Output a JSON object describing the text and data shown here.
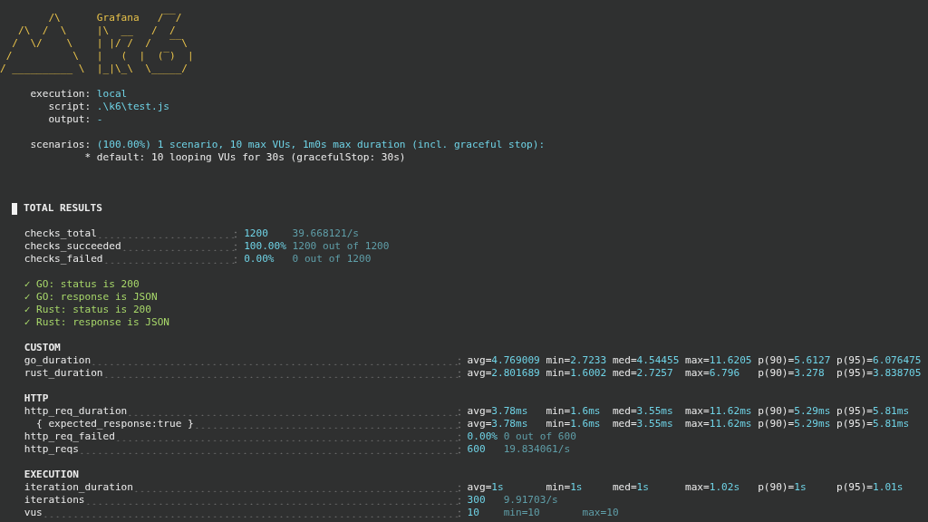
{
  "banner": {
    "lines": [
      "        /\\      Grafana   /‾‾/",
      "   /\\  /  \\     |\\  __   /  /",
      "  /  \\/    \\    | |/ /  /   ‾‾\\",
      " /          \\   |   (  |  (‾)  |",
      "/ __________ \\  |_|\\_\\  \\_____/"
    ]
  },
  "run_info": [
    {
      "field": "execution:",
      "setting": "local"
    },
    {
      "field": "script:",
      "setting": ".\\k6\\test.js"
    },
    {
      "field": "output:",
      "setting": "-"
    },
    {
      "field": "scenarios:",
      "setting": "(100.00%) 1 scenario, 10 max VUs, 1m0s max duration (incl. graceful stop):"
    }
  ],
  "scenario_detail": "* default: 10 looping VUs for 30s (gracefulStop: 30s)",
  "results_title": "TOTAL RESULTS",
  "checks": [
    {
      "name": "checks_total",
      "value": "1200",
      "extra": "39.668121/s"
    },
    {
      "name": "checks_succeeded",
      "value": "100.00%",
      "extra": "1200 out of 1200"
    },
    {
      "name": "checks_failed",
      "value": "0.00%",
      "extra": "0 out of 1200"
    }
  ],
  "check_list": [
    {
      "mark": "✓",
      "text": "GO: status is 200",
      "passed": true
    },
    {
      "mark": "✓",
      "text": "GO: response is JSON",
      "passed": true
    },
    {
      "mark": "✓",
      "text": "Rust: status is 200",
      "passed": true
    },
    {
      "mark": "✓",
      "text": "Rust: response is JSON",
      "passed": true
    }
  ],
  "groups": [
    {
      "title": "CUSTOM",
      "metrics": [
        {
          "kind": "trend",
          "name": "go_duration",
          "stats": [
            {
              "label": "avg=",
              "value": "4.769009"
            },
            {
              "label": "min=",
              "value": "2.7233"
            },
            {
              "label": "med=",
              "value": "4.54455"
            },
            {
              "label": "max=",
              "value": "11.6205"
            },
            {
              "label": "p(90)=",
              "value": "5.6127"
            },
            {
              "label": "p(95)=",
              "value": "6.076475"
            }
          ]
        },
        {
          "kind": "trend",
          "name": "rust_duration",
          "stats": [
            {
              "label": "avg=",
              "value": "2.801689"
            },
            {
              "label": "min=",
              "value": "1.6002"
            },
            {
              "label": "med=",
              "value": "2.7257"
            },
            {
              "label": "max=",
              "value": "6.796"
            },
            {
              "label": "p(90)=",
              "value": "3.278"
            },
            {
              "label": "p(95)=",
              "value": "3.838705"
            }
          ]
        }
      ]
    },
    {
      "title": "HTTP",
      "metrics": [
        {
          "kind": "trend",
          "name": "http_req_duration",
          "stats": [
            {
              "label": "avg=",
              "value": "3.78ms"
            },
            {
              "label": "min=",
              "value": "1.6ms"
            },
            {
              "label": "med=",
              "value": "3.55ms"
            },
            {
              "label": "max=",
              "value": "11.62ms"
            },
            {
              "label": "p(90)=",
              "value": "5.29ms"
            },
            {
              "label": "p(95)=",
              "value": "5.81ms"
            }
          ],
          "children": [
            {
              "kind": "trend",
              "name": "{ expected_response:true }",
              "stats": [
                {
                  "label": "avg=",
                  "value": "3.78ms"
                },
                {
                  "label": "min=",
                  "value": "1.6ms"
                },
                {
                  "label": "med=",
                  "value": "3.55ms"
                },
                {
                  "label": "max=",
                  "value": "11.62ms"
                },
                {
                  "label": "p(90)=",
                  "value": "5.29ms"
                },
                {
                  "label": "p(95)=",
                  "value": "5.81ms"
                }
              ]
            }
          ]
        },
        {
          "kind": "value",
          "name": "http_req_failed",
          "value": "0.00%",
          "extra": "0 out of 600"
        },
        {
          "kind": "value",
          "name": "http_reqs",
          "value": "600",
          "extra": "19.834061/s"
        }
      ]
    },
    {
      "title": "EXECUTION",
      "metrics": [
        {
          "kind": "trend",
          "name": "iteration_duration",
          "stats": [
            {
              "label": "avg=",
              "value": "1s"
            },
            {
              "label": "min=",
              "value": "1s"
            },
            {
              "label": "med=",
              "value": "1s"
            },
            {
              "label": "max=",
              "value": "1.02s"
            },
            {
              "label": "p(90)=",
              "value": "1s"
            },
            {
              "label": "p(95)=",
              "value": "1.01s"
            }
          ]
        },
        {
          "kind": "value",
          "name": "iterations",
          "value": "300",
          "extra": "9.91703/s"
        },
        {
          "kind": "value",
          "name": "vus",
          "value": "10",
          "extra": "min=10       max=10"
        }
      ]
    }
  ]
}
